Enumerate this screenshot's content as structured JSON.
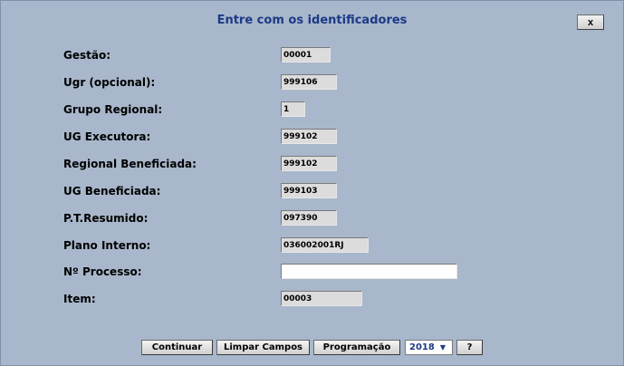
{
  "dialog": {
    "title": "Entre com os identificadores",
    "close_label": "x"
  },
  "fields": [
    {
      "label": "Gestão:",
      "value": "00001"
    },
    {
      "label": "Ugr (opcional):",
      "value": "999106"
    },
    {
      "label": "Grupo Regional:",
      "value": "1"
    },
    {
      "label": "UG Executora:",
      "value": "999102"
    },
    {
      "label": "Regional Beneficiada:",
      "value": "999102"
    },
    {
      "label": "UG Beneficiada:",
      "value": "999103"
    },
    {
      "label": "P.T.Resumido:",
      "value": "097390"
    },
    {
      "label": "Plano Interno:",
      "value": "036002001RJ"
    },
    {
      "label": "Nº Processo:",
      "value": ""
    },
    {
      "label": "Item:",
      "value": "00003"
    }
  ],
  "buttons": {
    "continue": "Continuar",
    "clear": "Limpar Campos",
    "schedule": "Programação",
    "year": "2018",
    "help": "?"
  }
}
